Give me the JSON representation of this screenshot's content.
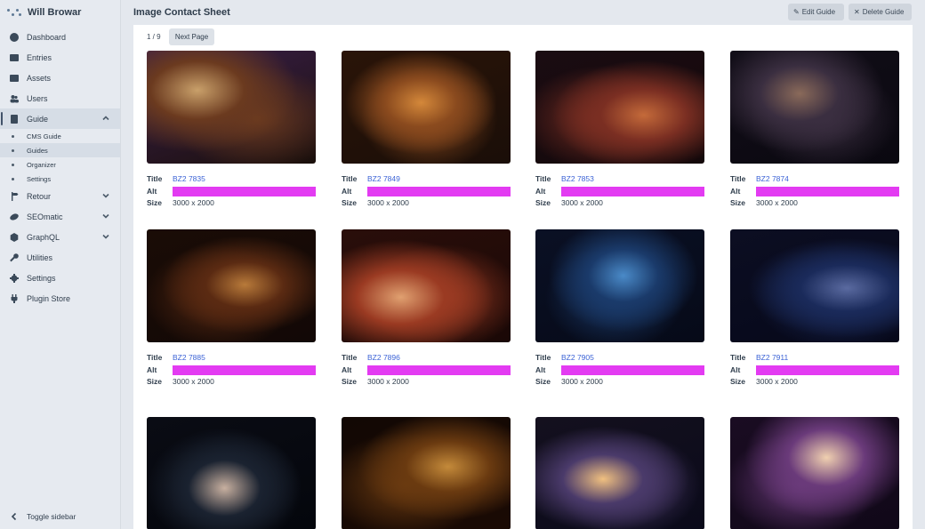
{
  "app": {
    "site_name": "Will Browar"
  },
  "sidebar": {
    "items": [
      {
        "label": "Dashboard",
        "icon": "dashboard-icon"
      },
      {
        "label": "Entries",
        "icon": "entries-icon"
      },
      {
        "label": "Assets",
        "icon": "image-icon"
      },
      {
        "label": "Users",
        "icon": "users-icon"
      },
      {
        "label": "Guide",
        "icon": "book-icon"
      },
      {
        "label": "Retour",
        "icon": "signpost-icon"
      },
      {
        "label": "SEOmatic",
        "icon": "seomatic-icon"
      },
      {
        "label": "GraphQL",
        "icon": "graphql-icon"
      },
      {
        "label": "Utilities",
        "icon": "wrench-icon"
      },
      {
        "label": "Settings",
        "icon": "gear-icon"
      },
      {
        "label": "Plugin Store",
        "icon": "plug-icon"
      }
    ],
    "guide_subitems": [
      {
        "label": "CMS Guide"
      },
      {
        "label": "Guides"
      },
      {
        "label": "Organizer"
      },
      {
        "label": "Settings"
      }
    ],
    "toggle_label": "Toggle sidebar"
  },
  "header": {
    "title": "Image Contact Sheet",
    "edit_label": "Edit Guide",
    "delete_label": "Delete Guide"
  },
  "pagination": {
    "page": "1 / 9",
    "next_label": "Next Page"
  },
  "labels": {
    "title": "Title",
    "alt": "Alt",
    "size": "Size"
  },
  "images": [
    {
      "title": "BZ2 7835",
      "size": "3000 x 2000"
    },
    {
      "title": "BZ2 7849",
      "size": "3000 x 2000"
    },
    {
      "title": "BZ2 7853",
      "size": "3000 x 2000"
    },
    {
      "title": "BZ2 7874",
      "size": "3000 x 2000"
    },
    {
      "title": "BZ2 7885",
      "size": "3000 x 2000"
    },
    {
      "title": "BZ2 7896",
      "size": "3000 x 2000"
    },
    {
      "title": "BZ2 7905",
      "size": "3000 x 2000"
    },
    {
      "title": "BZ2 7911",
      "size": "3000 x 2000"
    },
    {
      "title": "",
      "size": ""
    },
    {
      "title": "",
      "size": ""
    },
    {
      "title": "",
      "size": ""
    },
    {
      "title": "",
      "size": ""
    }
  ],
  "colors": {
    "alt_highlight": "#e33bf2",
    "link": "#3c63d6",
    "sidebar_bg": "#e6eaf0"
  }
}
